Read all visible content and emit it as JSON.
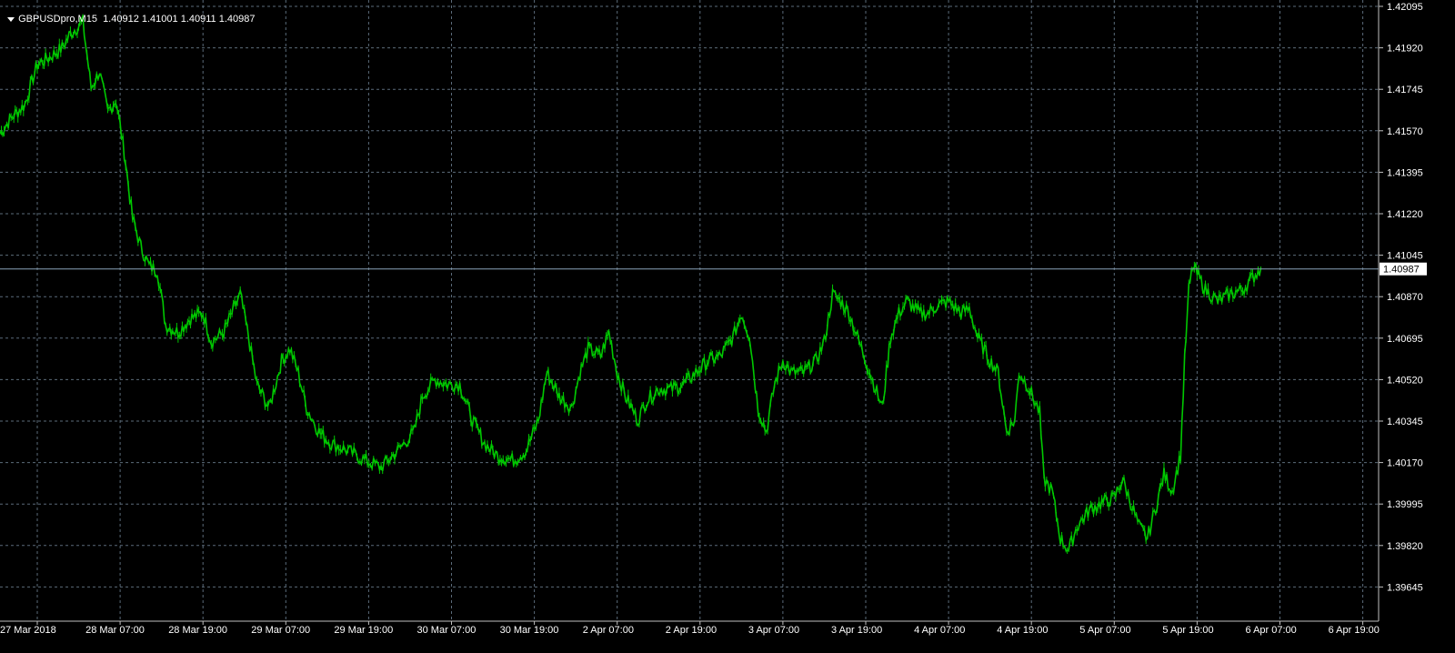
{
  "header": {
    "symbol": "GBPUSDpro,M15",
    "ohlc": "1.40912 1.41001 1.40911 1.40987"
  },
  "colors": {
    "background": "#000000",
    "grid": "#5b6b7a",
    "price_line": "#00c800",
    "current_price_line": "#8aa3b8",
    "text": "#ffffff"
  },
  "chart_data": {
    "type": "line",
    "symbol": "GBPUSDpro",
    "timeframe": "M15",
    "grid": true,
    "ylim": [
      1.3957,
      1.421
    ],
    "y_ticks": [
      "1.42095",
      "1.41920",
      "1.41745",
      "1.41570",
      "1.41395",
      "1.41220",
      "1.41045",
      "1.40870",
      "1.40695",
      "1.40520",
      "1.40345",
      "1.40170",
      "1.39995",
      "1.39820",
      "1.39645"
    ],
    "x_ticks": [
      "27 Mar 2018",
      "28 Mar 07:00",
      "28 Mar 19:00",
      "29 Mar 07:00",
      "29 Mar 19:00",
      "30 Mar 07:00",
      "30 Mar 19:00",
      "2 Apr 07:00",
      "2 Apr 19:00",
      "3 Apr 07:00",
      "3 Apr 19:00",
      "4 Apr 07:00",
      "4 Apr 19:00",
      "5 Apr 07:00",
      "5 Apr 19:00",
      "6 Apr 07:00",
      "6 Apr 19:00"
    ],
    "current_price": "1.40987",
    "series": [
      {
        "values": [
          [
            0,
            1.4156
          ],
          [
            0.15,
            1.4163
          ],
          [
            0.3,
            1.4168
          ],
          [
            0.45,
            1.4185
          ],
          [
            0.6,
            1.4188
          ],
          [
            0.75,
            1.4192
          ],
          [
            0.85,
            1.4198
          ],
          [
            1.0,
            1.4203
          ],
          [
            1.1,
            1.4175
          ],
          [
            1.2,
            1.4182
          ],
          [
            1.3,
            1.4165
          ],
          [
            1.4,
            1.417
          ],
          [
            1.5,
            1.4148
          ],
          [
            1.6,
            1.412
          ],
          [
            1.7,
            1.4108
          ],
          [
            1.8,
            1.41
          ],
          [
            1.9,
            1.4098
          ],
          [
            2.0,
            1.4075
          ],
          [
            2.15,
            1.4072
          ],
          [
            2.3,
            1.4078
          ],
          [
            2.45,
            1.408
          ],
          [
            2.55,
            1.4068
          ],
          [
            2.7,
            1.4072
          ],
          [
            2.8,
            1.408
          ],
          [
            2.9,
            1.4088
          ],
          [
            3.0,
            1.407
          ],
          [
            3.1,
            1.405
          ],
          [
            3.25,
            1.404
          ],
          [
            3.4,
            1.406
          ],
          [
            3.5,
            1.4065
          ],
          [
            3.6,
            1.4055
          ],
          [
            3.7,
            1.404
          ],
          [
            3.85,
            1.403
          ],
          [
            4.0,
            1.4025
          ],
          [
            4.2,
            1.4022
          ],
          [
            4.4,
            1.4018
          ],
          [
            4.6,
            1.4015
          ],
          [
            4.8,
            1.4022
          ],
          [
            5.0,
            1.403
          ],
          [
            5.1,
            1.4045
          ],
          [
            5.25,
            1.4052
          ],
          [
            5.4,
            1.405
          ],
          [
            5.55,
            1.405
          ],
          [
            5.7,
            1.4035
          ],
          [
            5.85,
            1.4025
          ],
          [
            6.0,
            1.402
          ],
          [
            6.2,
            1.4018
          ],
          [
            6.35,
            1.4022
          ],
          [
            6.5,
            1.4035
          ],
          [
            6.6,
            1.4055
          ],
          [
            6.75,
            1.4045
          ],
          [
            6.9,
            1.404
          ],
          [
            7.0,
            1.4055
          ],
          [
            7.1,
            1.4065
          ],
          [
            7.25,
            1.4062
          ],
          [
            7.35,
            1.4072
          ],
          [
            7.45,
            1.4055
          ],
          [
            7.55,
            1.4045
          ],
          [
            7.7,
            1.4035
          ],
          [
            7.8,
            1.4043
          ],
          [
            7.95,
            1.4048
          ],
          [
            8.1,
            1.4048
          ],
          [
            8.25,
            1.405
          ],
          [
            8.4,
            1.4055
          ],
          [
            8.55,
            1.406
          ],
          [
            8.7,
            1.4062
          ],
          [
            8.85,
            1.407
          ],
          [
            8.95,
            1.408
          ],
          [
            9.05,
            1.407
          ],
          [
            9.15,
            1.404
          ],
          [
            9.25,
            1.403
          ],
          [
            9.35,
            1.405
          ],
          [
            9.45,
            1.406
          ],
          [
            9.55,
            1.4055
          ],
          [
            9.7,
            1.4055
          ],
          [
            9.85,
            1.406
          ],
          [
            9.95,
            1.4068
          ],
          [
            10.05,
            1.4088
          ],
          [
            10.15,
            1.4085
          ],
          [
            10.25,
            1.408
          ],
          [
            10.35,
            1.407
          ],
          [
            10.45,
            1.406
          ],
          [
            10.55,
            1.405
          ],
          [
            10.65,
            1.404
          ],
          [
            10.75,
            1.407
          ],
          [
            10.85,
            1.408
          ],
          [
            10.95,
            1.4085
          ],
          [
            11.1,
            1.408
          ],
          [
            11.2,
            1.408
          ],
          [
            11.3,
            1.4083
          ],
          [
            11.45,
            1.4085
          ],
          [
            11.6,
            1.408
          ],
          [
            11.7,
            1.4082
          ],
          [
            11.8,
            1.407
          ],
          [
            11.95,
            1.406
          ],
          [
            12.05,
            1.4055
          ],
          [
            12.15,
            1.403
          ],
          [
            12.25,
            1.4035
          ],
          [
            12.3,
            1.4055
          ],
          [
            12.4,
            1.405
          ],
          [
            12.55,
            1.4038
          ],
          [
            12.6,
            1.401
          ],
          [
            12.7,
            1.4005
          ],
          [
            12.8,
            1.3985
          ],
          [
            12.9,
            1.398
          ],
          [
            13.0,
            1.399
          ],
          [
            13.15,
            1.3997
          ],
          [
            13.3,
            1.4
          ],
          [
            13.45,
            1.4002
          ],
          [
            13.55,
            1.401
          ],
          [
            13.65,
            1.4
          ],
          [
            13.75,
            1.399
          ],
          [
            13.85,
            1.3985
          ],
          [
            13.95,
            1.3998
          ],
          [
            14.05,
            1.4012
          ],
          [
            14.15,
            1.4005
          ],
          [
            14.25,
            1.402
          ],
          [
            14.3,
            1.406
          ],
          [
            14.35,
            1.409
          ],
          [
            14.4,
            1.41
          ],
          [
            14.55,
            1.409
          ],
          [
            14.7,
            1.4085
          ],
          [
            14.85,
            1.4088
          ],
          [
            15.0,
            1.409
          ],
          [
            15.12,
            1.4095
          ],
          [
            15.22,
            1.4099
          ]
        ]
      }
    ]
  }
}
